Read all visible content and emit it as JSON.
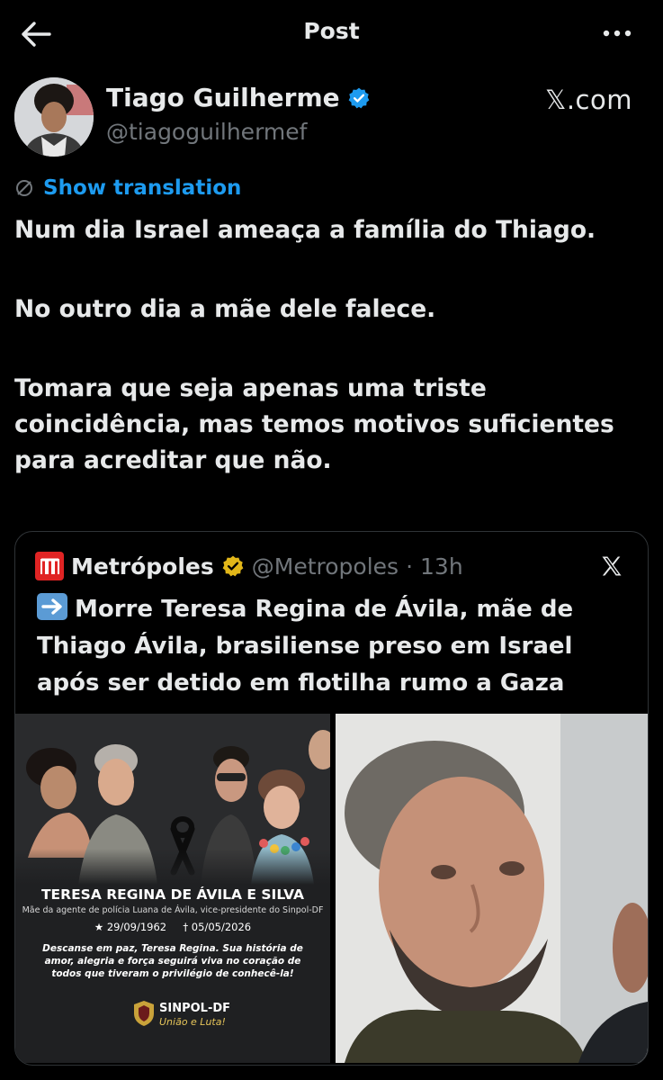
{
  "topbar": {
    "title": "Post"
  },
  "author": {
    "name": "Tiago Guilherme",
    "handle": "@tiagoguilhermef",
    "source": "𝕏.com"
  },
  "post": {
    "translate_label": "Show translation",
    "paragraphs": [
      "Num dia Israel ameaça a família do Thiago.",
      "No outro dia a mãe dele falece.",
      "Tomara que seja apenas uma triste coincidência, mas temos motivos suficientes para acreditar que não."
    ]
  },
  "quote": {
    "name": "Metrópoles",
    "handle": "@Metropoles",
    "separator": "·",
    "time": "13h",
    "text": "Morre Teresa Regina de Ávila, mãe de Thiago Ávila, brasiliense preso em Israel após ser detido em flotilha rumo a Gaza",
    "card": {
      "title": "TERESA REGINA DE ÁVILA E SILVA",
      "subtitle": "Mãe da agente de polícia Luana de Ávila, vice-presidente do Sinpol-DF",
      "birth": "★ 29/09/1962",
      "death": "† 05/05/2026",
      "message": "Descanse em paz, Teresa Regina. Sua história de amor, alegria e força seguirá viva no coração de todos que tiveram o privilégio de conhecê-la!",
      "org": "SINPOL-DF",
      "motto": "União e Luta!"
    }
  },
  "colors": {
    "accent": "#1d9bf0",
    "verified_blue": "#1d9bf0",
    "verified_gold": "#e2b719",
    "brand_red": "#e02424"
  }
}
